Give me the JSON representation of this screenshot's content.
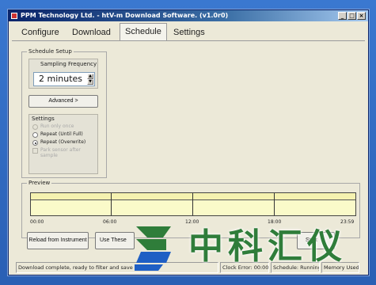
{
  "window": {
    "title": "PPM Technology Ltd. - htV-m Download Software. (v1.0r0)"
  },
  "window_controls": [
    "_",
    "□",
    "×"
  ],
  "tabs": [
    {
      "label": "Configure"
    },
    {
      "label": "Download"
    },
    {
      "label": "Schedule"
    },
    {
      "label": "Settings"
    }
  ],
  "schedule_setup": {
    "title": "Schedule Setup",
    "sampling_frequency_label": "Sampling Frequency",
    "sampling_frequency_value": "2 minutes",
    "advanced_button": "Advanced >",
    "settings_title": "Settings",
    "options": [
      {
        "label": "Run only once",
        "enabled": false,
        "selected": false
      },
      {
        "label": "Repeat (Until Full)",
        "enabled": true,
        "selected": false
      },
      {
        "label": "Repeat (Overwrite)",
        "enabled": true,
        "selected": true
      }
    ],
    "park_sensor_label": "Park sensor after",
    "park_sensor_label2": "sample"
  },
  "preview": {
    "title": "Preview",
    "ticks": [
      "00:00",
      "06:00",
      "12:00",
      "18:00",
      "23:59"
    ]
  },
  "buttons": {
    "reload": "Reload from Instrument",
    "use_these": "Use These",
    "start": "Start"
  },
  "status": {
    "message": "Download complete, ready to filter and save data.",
    "clock_error": "Clock Error: 00:00:14",
    "schedule": "Schedule: Running",
    "memory": "Memory Used:0%"
  },
  "watermark": {
    "text": "中科汇仪"
  },
  "colors": {
    "title_start": "#0a246a",
    "preview_fill": "#fafac9",
    "watermark_green": "#2f7d3a",
    "watermark_blue": "#1f5fc4"
  }
}
